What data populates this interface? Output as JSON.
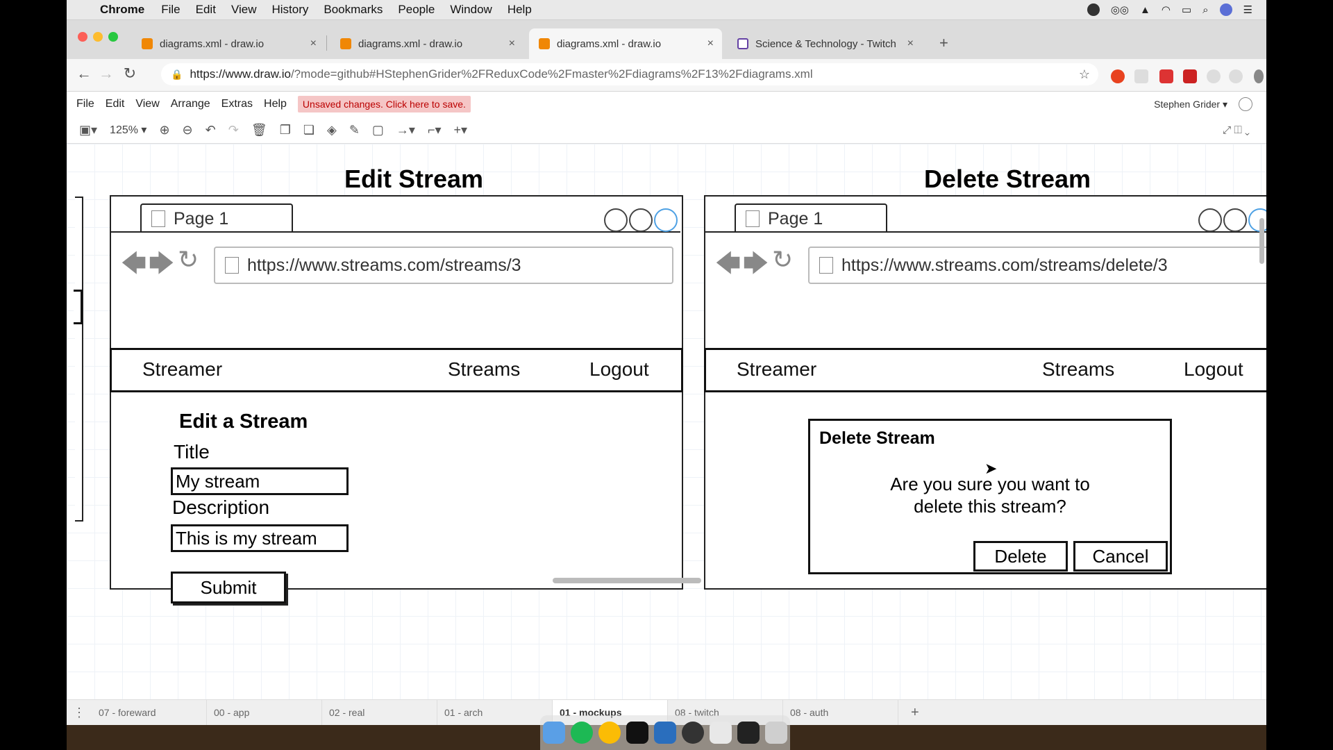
{
  "menubar": {
    "app_name": "Chrome",
    "items": [
      "File",
      "Edit",
      "View",
      "History",
      "Bookmarks",
      "People",
      "Window",
      "Help"
    ]
  },
  "tabs": [
    {
      "title": "diagrams.xml - draw.io",
      "active": false
    },
    {
      "title": "diagrams.xml - draw.io",
      "active": false
    },
    {
      "title": "diagrams.xml - draw.io",
      "active": true
    },
    {
      "title": "Science & Technology - Twitch",
      "active": false
    }
  ],
  "address": {
    "host": "https://www.draw.io",
    "path": "/?mode=github#HStephenGrider%2FReduxCode%2Fmaster%2Fdiagrams%2F13%2Fdiagrams.xml"
  },
  "drawio": {
    "menu": [
      "File",
      "Edit",
      "View",
      "Arrange",
      "Extras",
      "Help"
    ],
    "unsaved": "Unsaved changes. Click here to save.",
    "user": "Stephen Grider",
    "zoom": "125%"
  },
  "edit_mock": {
    "title": "Edit Stream",
    "tab": "Page 1",
    "url": "https://www.streams.com/streams/3",
    "nav_brand": "Streamer",
    "nav_streams": "Streams",
    "nav_logout": "Logout",
    "heading": "Edit a Stream",
    "label_title": "Title",
    "value_title": "My stream",
    "label_description": "Description",
    "value_description": "This is my stream",
    "submit": "Submit"
  },
  "delete_mock": {
    "title": "Delete Stream",
    "tab": "Page 1",
    "url": "https://www.streams.com/streams/delete/3",
    "nav_brand": "Streamer",
    "nav_streams": "Streams",
    "nav_logout": "Logout",
    "modal_title": "Delete Stream",
    "modal_line1": "Are you sure you want to",
    "modal_line2": "delete this stream?",
    "delete": "Delete",
    "cancel": "Cancel"
  },
  "page_tabs": [
    "07 - foreward",
    "00 - app",
    "02 - real",
    "01 - arch",
    "01 - mockups",
    "08 - twitch",
    "08 - auth"
  ],
  "active_page_tab": "01 - mockups"
}
